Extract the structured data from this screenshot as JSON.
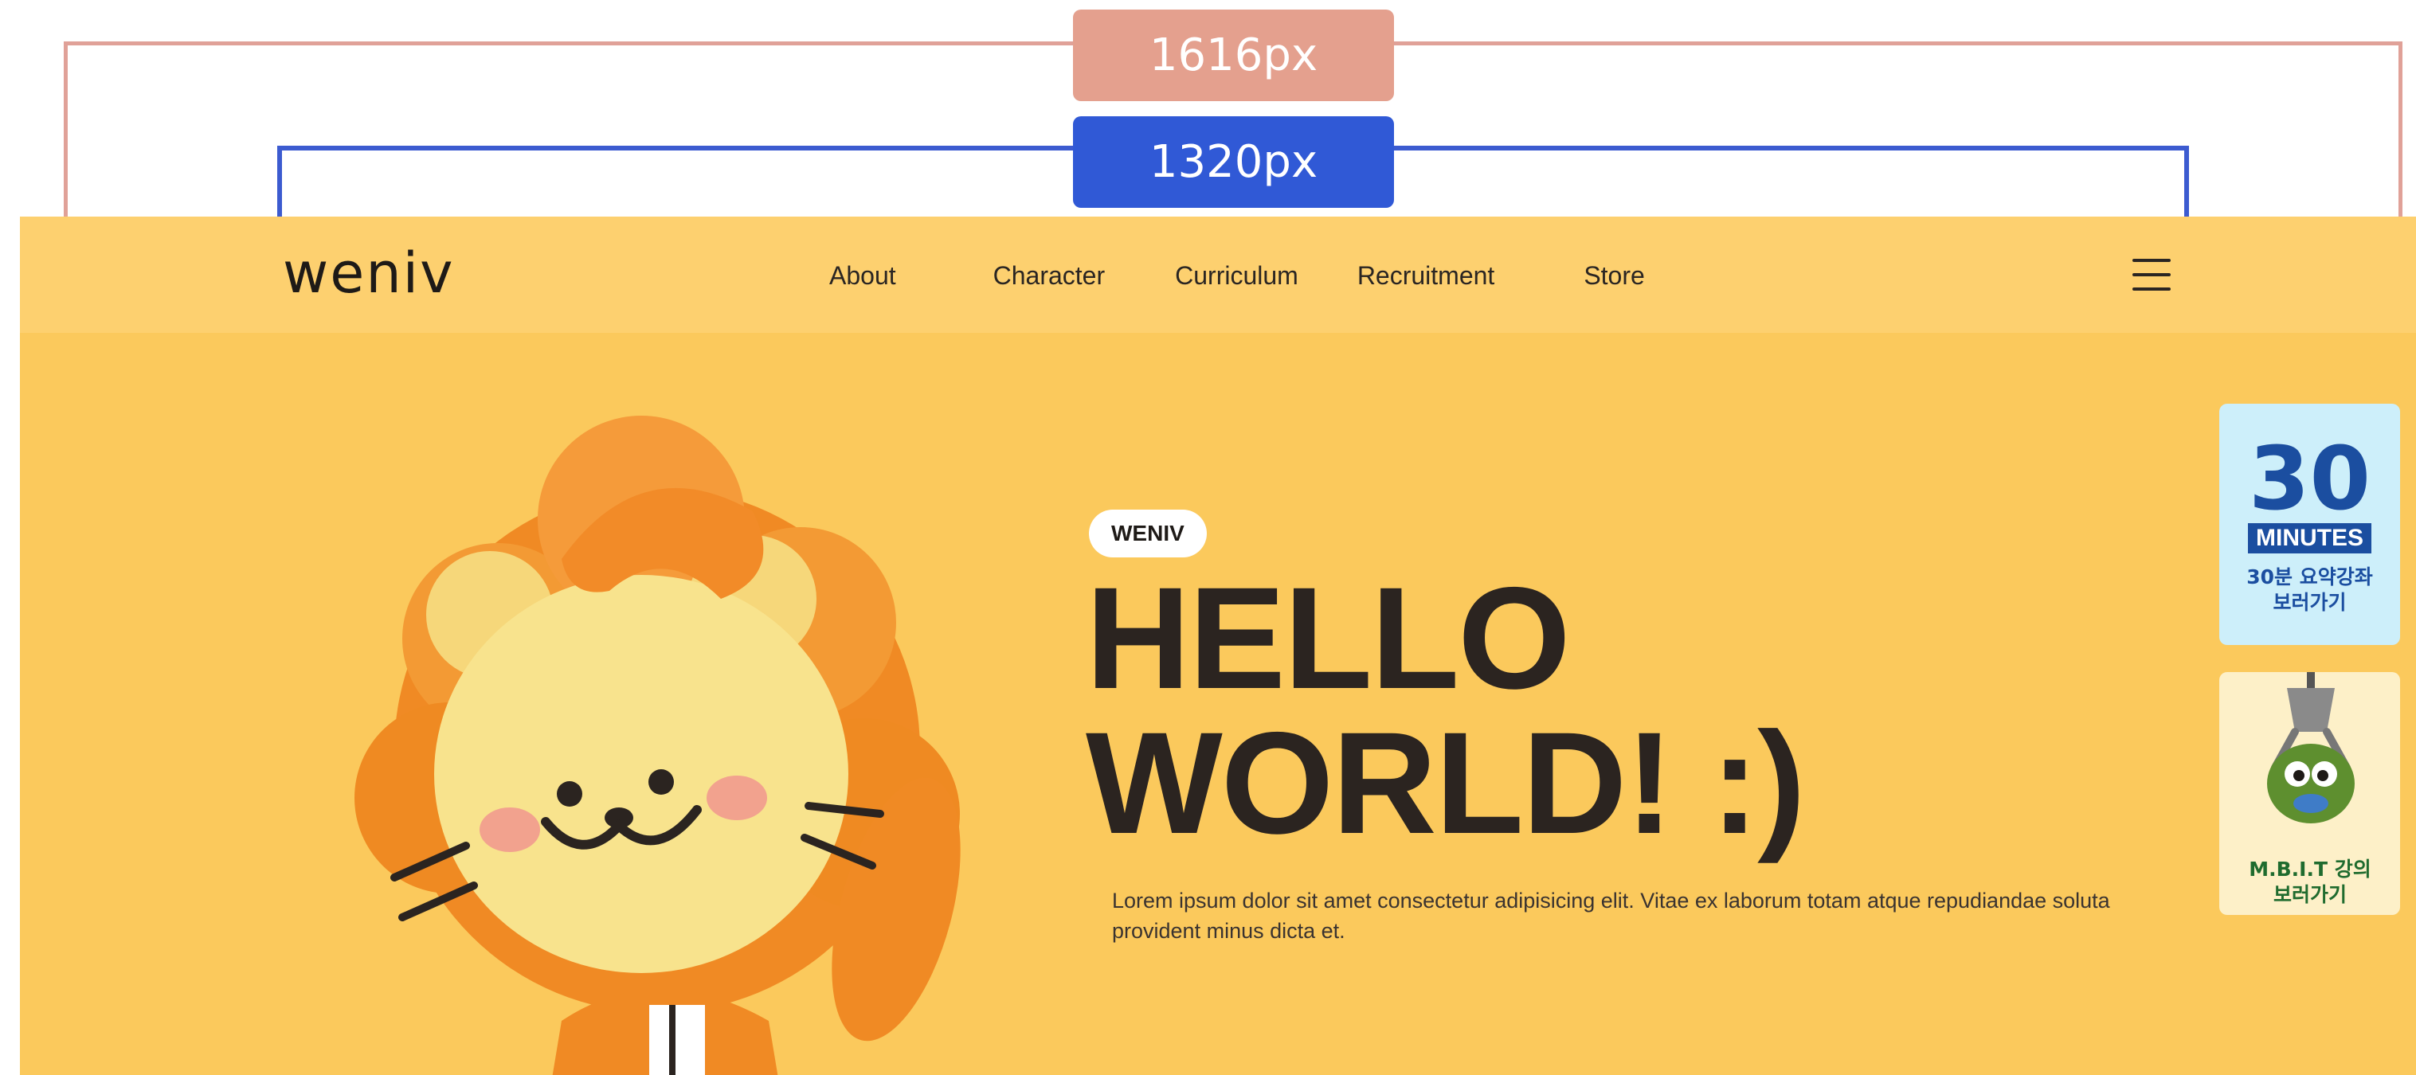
{
  "guides": {
    "outer_label": "1616px",
    "inner_label": "1320px"
  },
  "header": {
    "logo": "weniv",
    "nav": [
      "About",
      "Character",
      "Curriculum",
      "Recruitment",
      "Store"
    ]
  },
  "hero": {
    "badge": "WENIV",
    "title_line1": "HELLO",
    "title_line2": "WORLD! :)",
    "description": "Lorem ipsum dolor sit amet consectetur adipisicing elit. Vitae ex laborum totam atque repudiandae soluta provident minus dicta et."
  },
  "side_cards": [
    {
      "number": "30",
      "chip": "MINUTES",
      "caption_line1": "30분 요약강좌",
      "caption_line2": "보러가기"
    },
    {
      "caption_line1": "M.B.I.T 강의",
      "caption_line2": "보러가기"
    }
  ],
  "colors": {
    "background": "#fbc95c",
    "header": "#fdd06f",
    "text": "#2b2420",
    "accent_blue": "#1b4ea0"
  }
}
